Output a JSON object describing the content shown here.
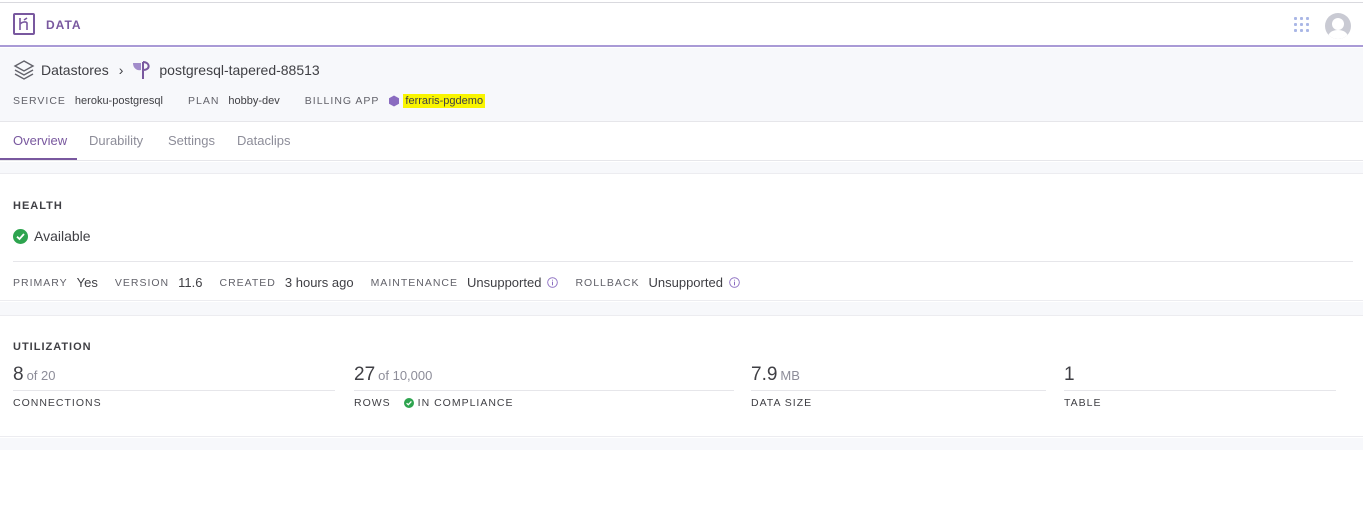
{
  "app": {
    "brand": "DATA",
    "logo_icon": "heroku-logo-icon",
    "apps_icon": "apps-grid-icon",
    "avatar_icon": "user-avatar-icon"
  },
  "breadcrumb": {
    "root": "Datastores",
    "current": "postgresql-tapered-88513"
  },
  "meta": {
    "service_label": "SERVICE",
    "service_value": "heroku-postgresql",
    "plan_label": "PLAN",
    "plan_value": "hobby-dev",
    "billing_label": "BILLING APP",
    "billing_value": "ferraris-pgdemo"
  },
  "tabs": [
    {
      "label": "Overview",
      "active": true
    },
    {
      "label": "Durability",
      "active": false
    },
    {
      "label": "Settings",
      "active": false
    },
    {
      "label": "Dataclips",
      "active": false
    }
  ],
  "health": {
    "title": "HEALTH",
    "status": "Available",
    "fields": {
      "primary_label": "PRIMARY",
      "primary_value": "Yes",
      "version_label": "VERSION",
      "version_value": "11.6",
      "created_label": "CREATED",
      "created_value": "3 hours ago",
      "maintenance_label": "MAINTENANCE",
      "maintenance_value": "Unsupported",
      "rollback_label": "ROLLBACK",
      "rollback_value": "Unsupported"
    }
  },
  "utilization": {
    "title": "UTILIZATION",
    "connections": {
      "value": "8",
      "of": "of 20",
      "label": "CONNECTIONS"
    },
    "rows": {
      "value": "27",
      "of": "of 10,000",
      "label": "ROWS",
      "compliance": "IN COMPLIANCE"
    },
    "data_size": {
      "value": "7.9",
      "unit": "MB",
      "label": "DATA SIZE"
    },
    "tables": {
      "value": "1",
      "label": "TABLE"
    }
  },
  "colors": {
    "accent": "#79589f",
    "success": "#2ea44f",
    "highlight": "#f9f500"
  }
}
